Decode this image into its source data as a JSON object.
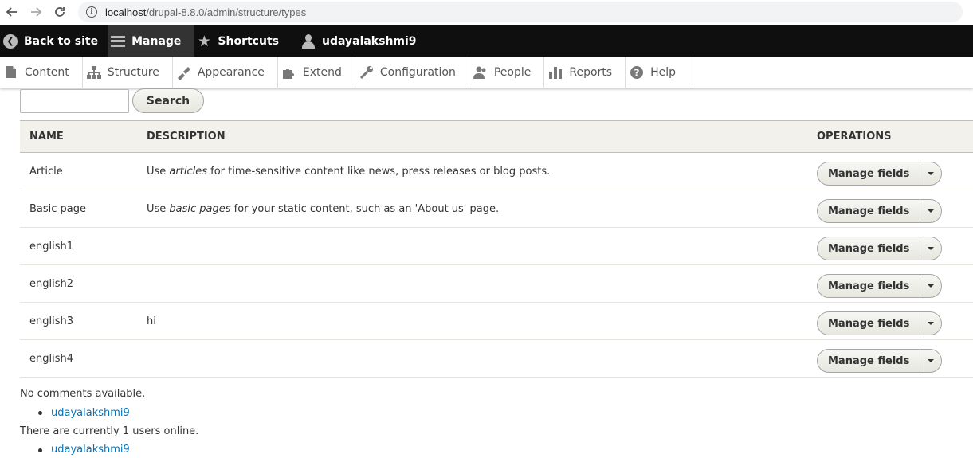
{
  "browser": {
    "url_host": "localhost",
    "url_path": "/drupal-8.8.0/admin/structure/types"
  },
  "toolbar": {
    "back_to_site": "Back to site",
    "manage": "Manage",
    "shortcuts": "Shortcuts",
    "user": "udayalakshmi9"
  },
  "tray": {
    "items": [
      {
        "label": "Content",
        "icon": "file-icon"
      },
      {
        "label": "Structure",
        "icon": "sitemap-icon"
      },
      {
        "label": "Appearance",
        "icon": "paintbrush-icon"
      },
      {
        "label": "Extend",
        "icon": "puzzle-icon"
      },
      {
        "label": "Configuration",
        "icon": "wrench-icon"
      },
      {
        "label": "People",
        "icon": "people-icon"
      },
      {
        "label": "Reports",
        "icon": "bar-chart-icon"
      },
      {
        "label": "Help",
        "icon": "help-icon"
      }
    ]
  },
  "search": {
    "value": "",
    "button_label": "Search"
  },
  "table": {
    "headers": {
      "name": "NAME",
      "description": "DESCRIPTION",
      "operations": "OPERATIONS"
    },
    "rows": [
      {
        "name": "Article",
        "desc_pre": "Use ",
        "desc_em": "articles",
        "desc_post": " for time-sensitive content like news, press releases or blog posts.",
        "operation": "Manage fields"
      },
      {
        "name": "Basic page",
        "desc_pre": "Use ",
        "desc_em": "basic pages",
        "desc_post": " for your static content, such as an 'About us' page.",
        "operation": "Manage fields"
      },
      {
        "name": "english1",
        "desc_pre": "",
        "desc_em": "",
        "desc_post": "",
        "operation": "Manage fields"
      },
      {
        "name": "english2",
        "desc_pre": "",
        "desc_em": "",
        "desc_post": "",
        "operation": "Manage fields"
      },
      {
        "name": "english3",
        "desc_pre": "hi",
        "desc_em": "",
        "desc_post": "",
        "operation": "Manage fields"
      },
      {
        "name": "english4",
        "desc_pre": "",
        "desc_em": "",
        "desc_post": "",
        "operation": "Manage fields"
      }
    ]
  },
  "footer": {
    "no_comments": "No comments available.",
    "user_link_1": "udayalakshmi9",
    "online_text": "There are currently 1 users online.",
    "user_link_2": "udayalakshmi9"
  }
}
